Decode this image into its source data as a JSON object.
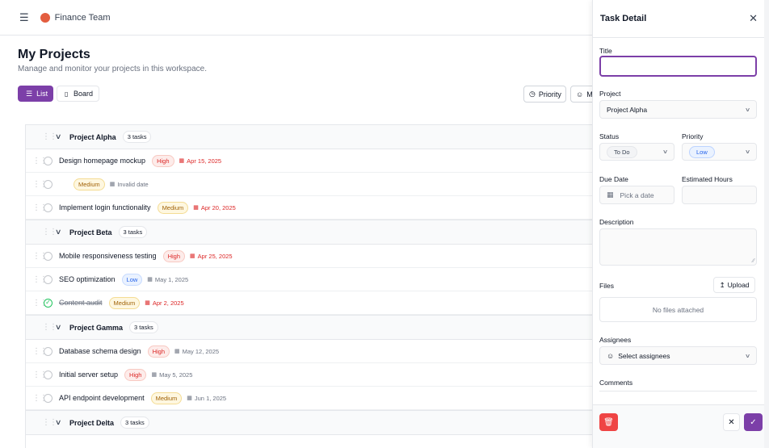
{
  "topbar": {
    "menu_icon": "hamburger-icon",
    "team_name": "Finance Team",
    "team_color": "#e35d3f"
  },
  "header": {
    "title": "My Projects",
    "subtitle": "Manage and monitor your projects in this workspace."
  },
  "views": {
    "list_label": "List",
    "board_label": "Board",
    "active": "List"
  },
  "toolbar": {
    "priority_label": "Priority",
    "member_label": "M"
  },
  "groups": [
    {
      "name": "Project Alpha",
      "count": "3 tasks",
      "tasks": [
        {
          "name": "Design homepage mockup",
          "priority": "High",
          "date": "Apr 15, 2025",
          "date_color": "red",
          "done": false
        },
        {
          "name": "",
          "priority": "Medium",
          "date": "Invalid date",
          "date_color": "gray",
          "done": false
        },
        {
          "name": "Implement login functionality",
          "priority": "Medium",
          "date": "Apr 20, 2025",
          "date_color": "red",
          "done": false
        }
      ]
    },
    {
      "name": "Project Beta",
      "count": "3 tasks",
      "tasks": [
        {
          "name": "Mobile responsiveness testing",
          "priority": "High",
          "date": "Apr 25, 2025",
          "date_color": "red",
          "done": false
        },
        {
          "name": "SEO optimization",
          "priority": "Low",
          "date": "May 1, 2025",
          "date_color": "gray",
          "done": false
        },
        {
          "name": "Content audit",
          "priority": "Medium",
          "date": "Apr 2, 2025",
          "date_color": "red",
          "done": true
        }
      ]
    },
    {
      "name": "Project Gamma",
      "count": "3 tasks",
      "tasks": [
        {
          "name": "Database schema design",
          "priority": "High",
          "date": "May 12, 2025",
          "date_color": "gray",
          "done": false
        },
        {
          "name": "Initial server setup",
          "priority": "High",
          "date": "May 5, 2025",
          "date_color": "gray",
          "done": false
        },
        {
          "name": "API endpoint development",
          "priority": "Medium",
          "date": "Jun 1, 2025",
          "date_color": "gray",
          "done": false
        }
      ]
    },
    {
      "name": "Project Delta",
      "count": "3 tasks",
      "tasks": []
    }
  ],
  "detail": {
    "title": "Task Detail",
    "title_label": "Title",
    "title_value": "",
    "project_label": "Project",
    "project_value": "Project Alpha",
    "status_label": "Status",
    "status_value": "To Do",
    "priority_label": "Priority",
    "priority_value": "Low",
    "due_label": "Due Date",
    "due_placeholder": "Pick a date",
    "hours_label": "Estimated Hours",
    "hours_value": "",
    "description_label": "Description",
    "description_value": "",
    "files_label": "Files",
    "upload_label": "Upload",
    "files_empty": "No files attached",
    "assignees_label": "Assignees",
    "assignees_placeholder": "Select assignees",
    "comments_label": "Comments"
  },
  "colors": {
    "accent": "#7c3fa8",
    "danger": "#ef4444"
  }
}
